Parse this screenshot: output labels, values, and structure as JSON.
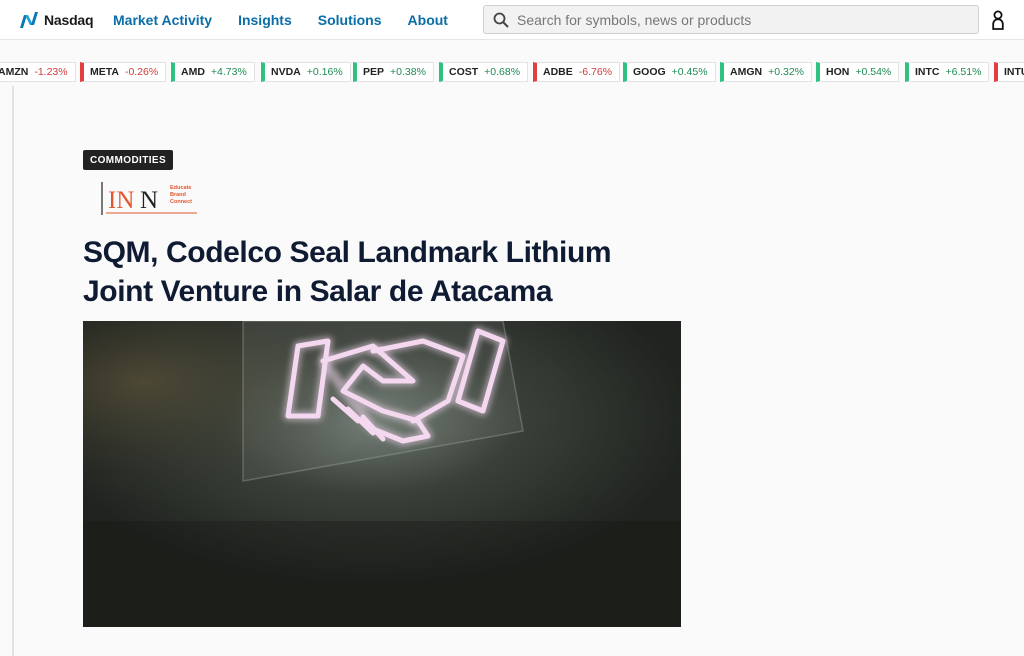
{
  "header": {
    "logo_text": "Nasdaq",
    "nav": [
      "Market Activity",
      "Insights",
      "Solutions",
      "About"
    ],
    "search_placeholder": "Search for symbols, news or products"
  },
  "ticker": [
    {
      "symbol": "AMZN",
      "change": "-1.23%",
      "direction": "down"
    },
    {
      "symbol": "META",
      "change": "-0.26%",
      "direction": "down"
    },
    {
      "symbol": "AMD",
      "change": "+4.73%",
      "direction": "up"
    },
    {
      "symbol": "NVDA",
      "change": "+0.16%",
      "direction": "up"
    },
    {
      "symbol": "PEP",
      "change": "+0.38%",
      "direction": "up"
    },
    {
      "symbol": "COST",
      "change": "+0.68%",
      "direction": "up"
    },
    {
      "symbol": "ADBE",
      "change": "-6.76%",
      "direction": "down"
    },
    {
      "symbol": "GOOG",
      "change": "+0.45%",
      "direction": "up"
    },
    {
      "symbol": "AMGN",
      "change": "+0.32%",
      "direction": "up"
    },
    {
      "symbol": "HON",
      "change": "+0.54%",
      "direction": "up"
    },
    {
      "symbol": "INTC",
      "change": "+6.51%",
      "direction": "up"
    },
    {
      "symbol": "INTU",
      "change": "",
      "direction": "down"
    }
  ],
  "article": {
    "category": "COMMODITIES",
    "publisher_logo": {
      "name": "INN",
      "tagline": [
        "Educate",
        "Brand",
        "Connect"
      ]
    },
    "headline": "SQM, Codelco Seal Landmark Lithium Joint Venture in Salar de Atacama",
    "hero_image": "neon handshake sign on dark wall"
  },
  "colors": {
    "nav_link": "#0a6ea8",
    "up": "#2ec27e",
    "down": "#e04040",
    "headline": "#0f1b33",
    "inn_accent": "#e4572e"
  }
}
